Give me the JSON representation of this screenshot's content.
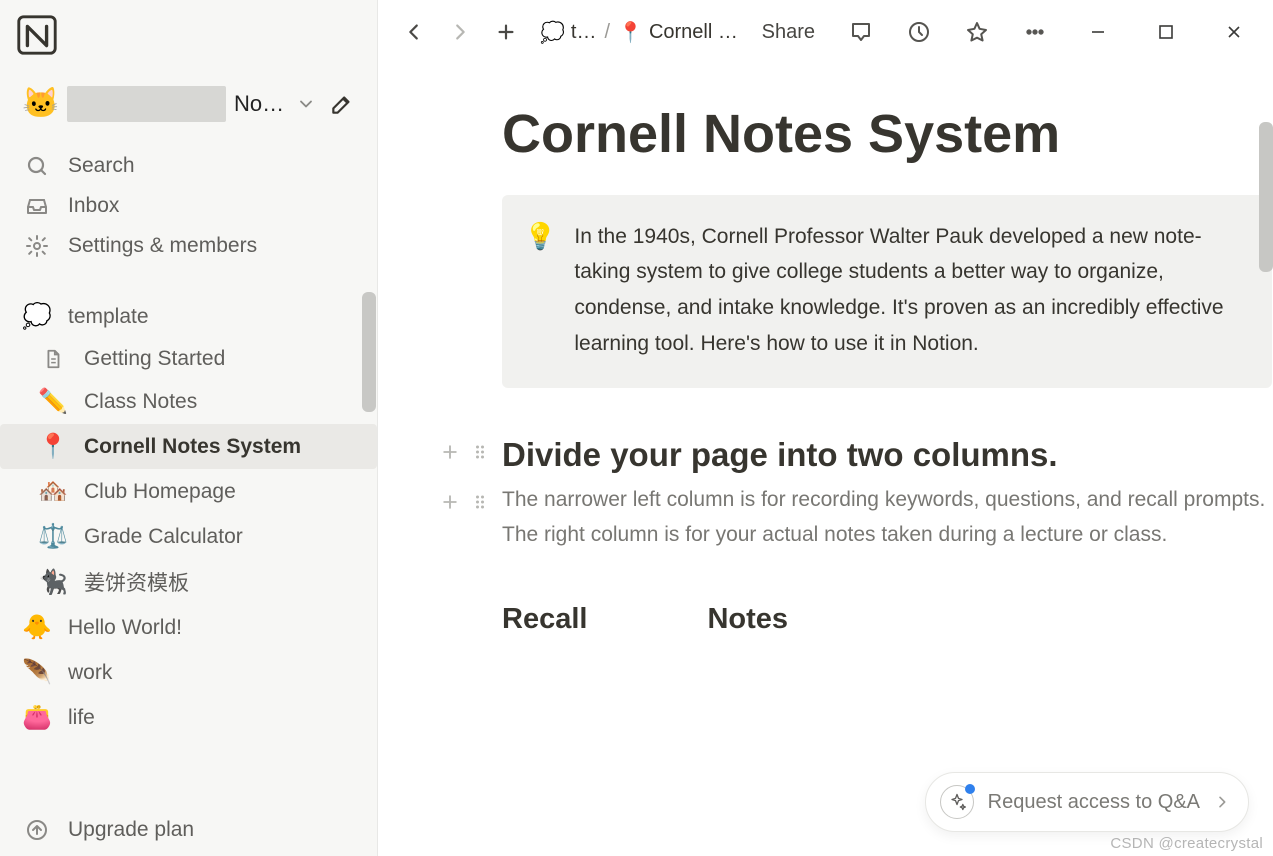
{
  "workspace": {
    "emoji": "🐱",
    "name_truncated": "No…"
  },
  "sidebar": {
    "search_label": "Search",
    "inbox_label": "Inbox",
    "settings_label": "Settings & members",
    "upgrade_label": "Upgrade plan",
    "pages": [
      {
        "emoji": "💭",
        "label": "template",
        "level": 0
      },
      {
        "emoji": "page",
        "label": "Getting Started",
        "level": 1
      },
      {
        "emoji": "✏️",
        "label": "Class Notes",
        "level": 1
      },
      {
        "emoji": "📍",
        "label": "Cornell Notes System",
        "level": 1,
        "active": true
      },
      {
        "emoji": "🏘️",
        "label": "Club Homepage",
        "level": 1
      },
      {
        "emoji": "⚖️",
        "label": "Grade Calculator",
        "level": 1
      },
      {
        "emoji": "🐈‍⬛",
        "label": "姜饼资模板",
        "level": 1
      },
      {
        "emoji": "🐥",
        "label": "Hello World!",
        "level": 0
      },
      {
        "emoji": "🪶",
        "label": "work",
        "level": 0
      },
      {
        "emoji": "👛",
        "label": "life",
        "level": 0
      }
    ]
  },
  "topbar": {
    "crumb1_emoji": "💭",
    "crumb1_label": "t…",
    "crumb2_emoji": "📍",
    "crumb2_label": "Cornell …",
    "share_label": "Share"
  },
  "page": {
    "title": "Cornell Notes System",
    "callout_emoji": "💡",
    "callout_text": "In the 1940s, Cornell Professor Walter Pauk developed a new note-taking system to give college students a better way to organize, condense, and intake knowledge. It's proven as an incredibly effective learning tool. Here's how to use it in Notion.",
    "h2": "Divide your page into two columns.",
    "p1": "The narrower left column is for recording keywords, questions, and recall prompts. The right column is for your actual notes taken during a lecture or class.",
    "col1": "Recall",
    "col2": "Notes"
  },
  "qa": {
    "label": "Request access to Q&A"
  },
  "watermark": "CSDN @createcrystal"
}
